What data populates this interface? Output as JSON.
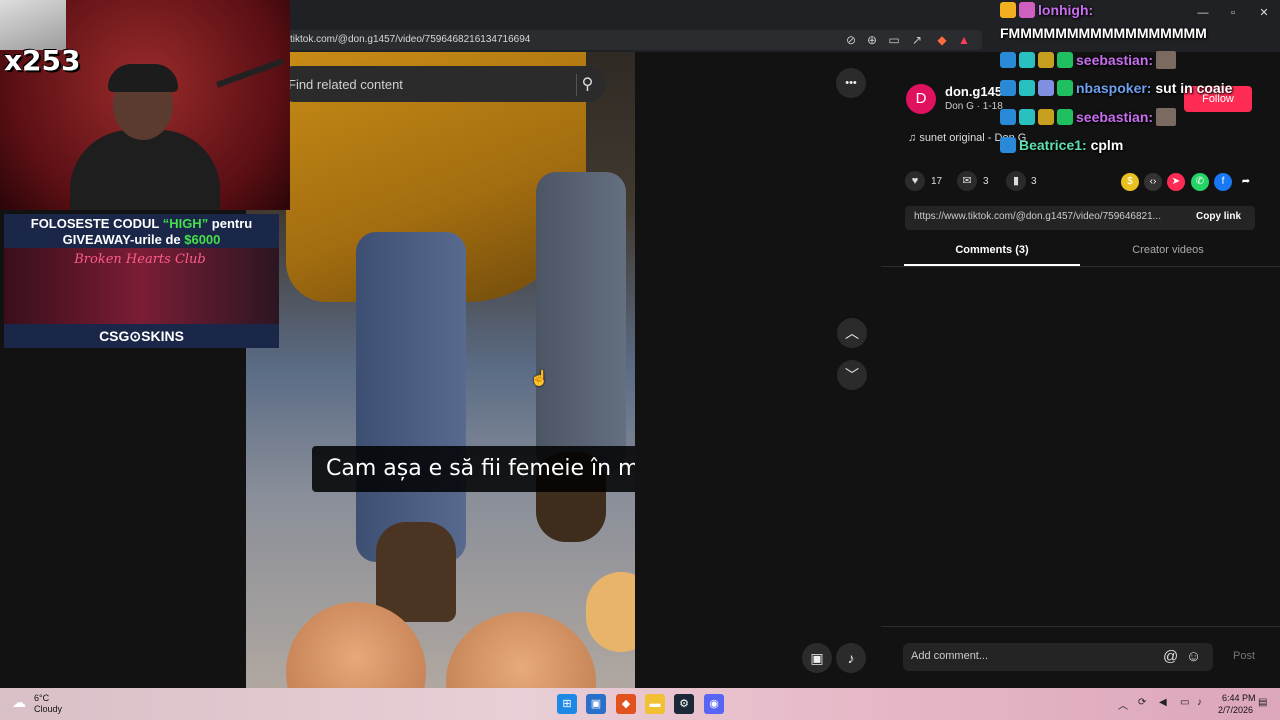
{
  "browser": {
    "url": "tiktok.com/@don.g1457/video/7596468216134716694",
    "window_controls": [
      "—",
      "▫",
      "✕"
    ]
  },
  "video": {
    "search_placeholder": "Find related content",
    "subtitle": "Cam așa e să fii femeie în metrou",
    "more_label": "•••"
  },
  "post": {
    "avatar_letter": "D",
    "username": "don.g145",
    "subname": "Don G · 1-18",
    "follow_label": "Follow",
    "sound": "sunet original - Don G",
    "likes": "17",
    "comments": "3",
    "saves": "3",
    "link": "https://www.tiktok.com/@don.g1457/video/759646821...",
    "copy_link_label": "Copy link",
    "tab_comments": "Comments (3)",
    "tab_creator": "Creator videos",
    "comment_placeholder": "Add comment...",
    "post_label": "Post"
  },
  "chat": [
    {
      "user": "lonhigh:",
      "message": "",
      "color": "#c86ef0"
    },
    {
      "user": "",
      "message": "FMMMMMMMMMMMMMMMMM",
      "color": "#ffffff"
    },
    {
      "user": "seebastian:",
      "message": "",
      "color": "#c86ef0"
    },
    {
      "user": "nbaspoker:",
      "message": "sut in coaie",
      "color": "#6ea0f0"
    },
    {
      "user": "seebastian:",
      "message": "",
      "color": "#c86ef0"
    },
    {
      "user": "Beatrice1:",
      "message": "cplm",
      "color": "#5fe0b0"
    }
  ],
  "stream": {
    "counter": "x253",
    "ad_line1": "FOLOSESTE CODUL ",
    "ad_code": "“HIGH”",
    "ad_line1b": " pentru",
    "ad_line2": "GIVEAWAY-urile de ",
    "ad_amount": "$6000",
    "ad_club": "Broken Hearts Club",
    "ad_brand": "CSG⊙SKINS"
  },
  "taskbar": {
    "temp": "6°C",
    "weather": "Cloudy",
    "time": "6:44 PM",
    "date": "2/7/2026"
  }
}
